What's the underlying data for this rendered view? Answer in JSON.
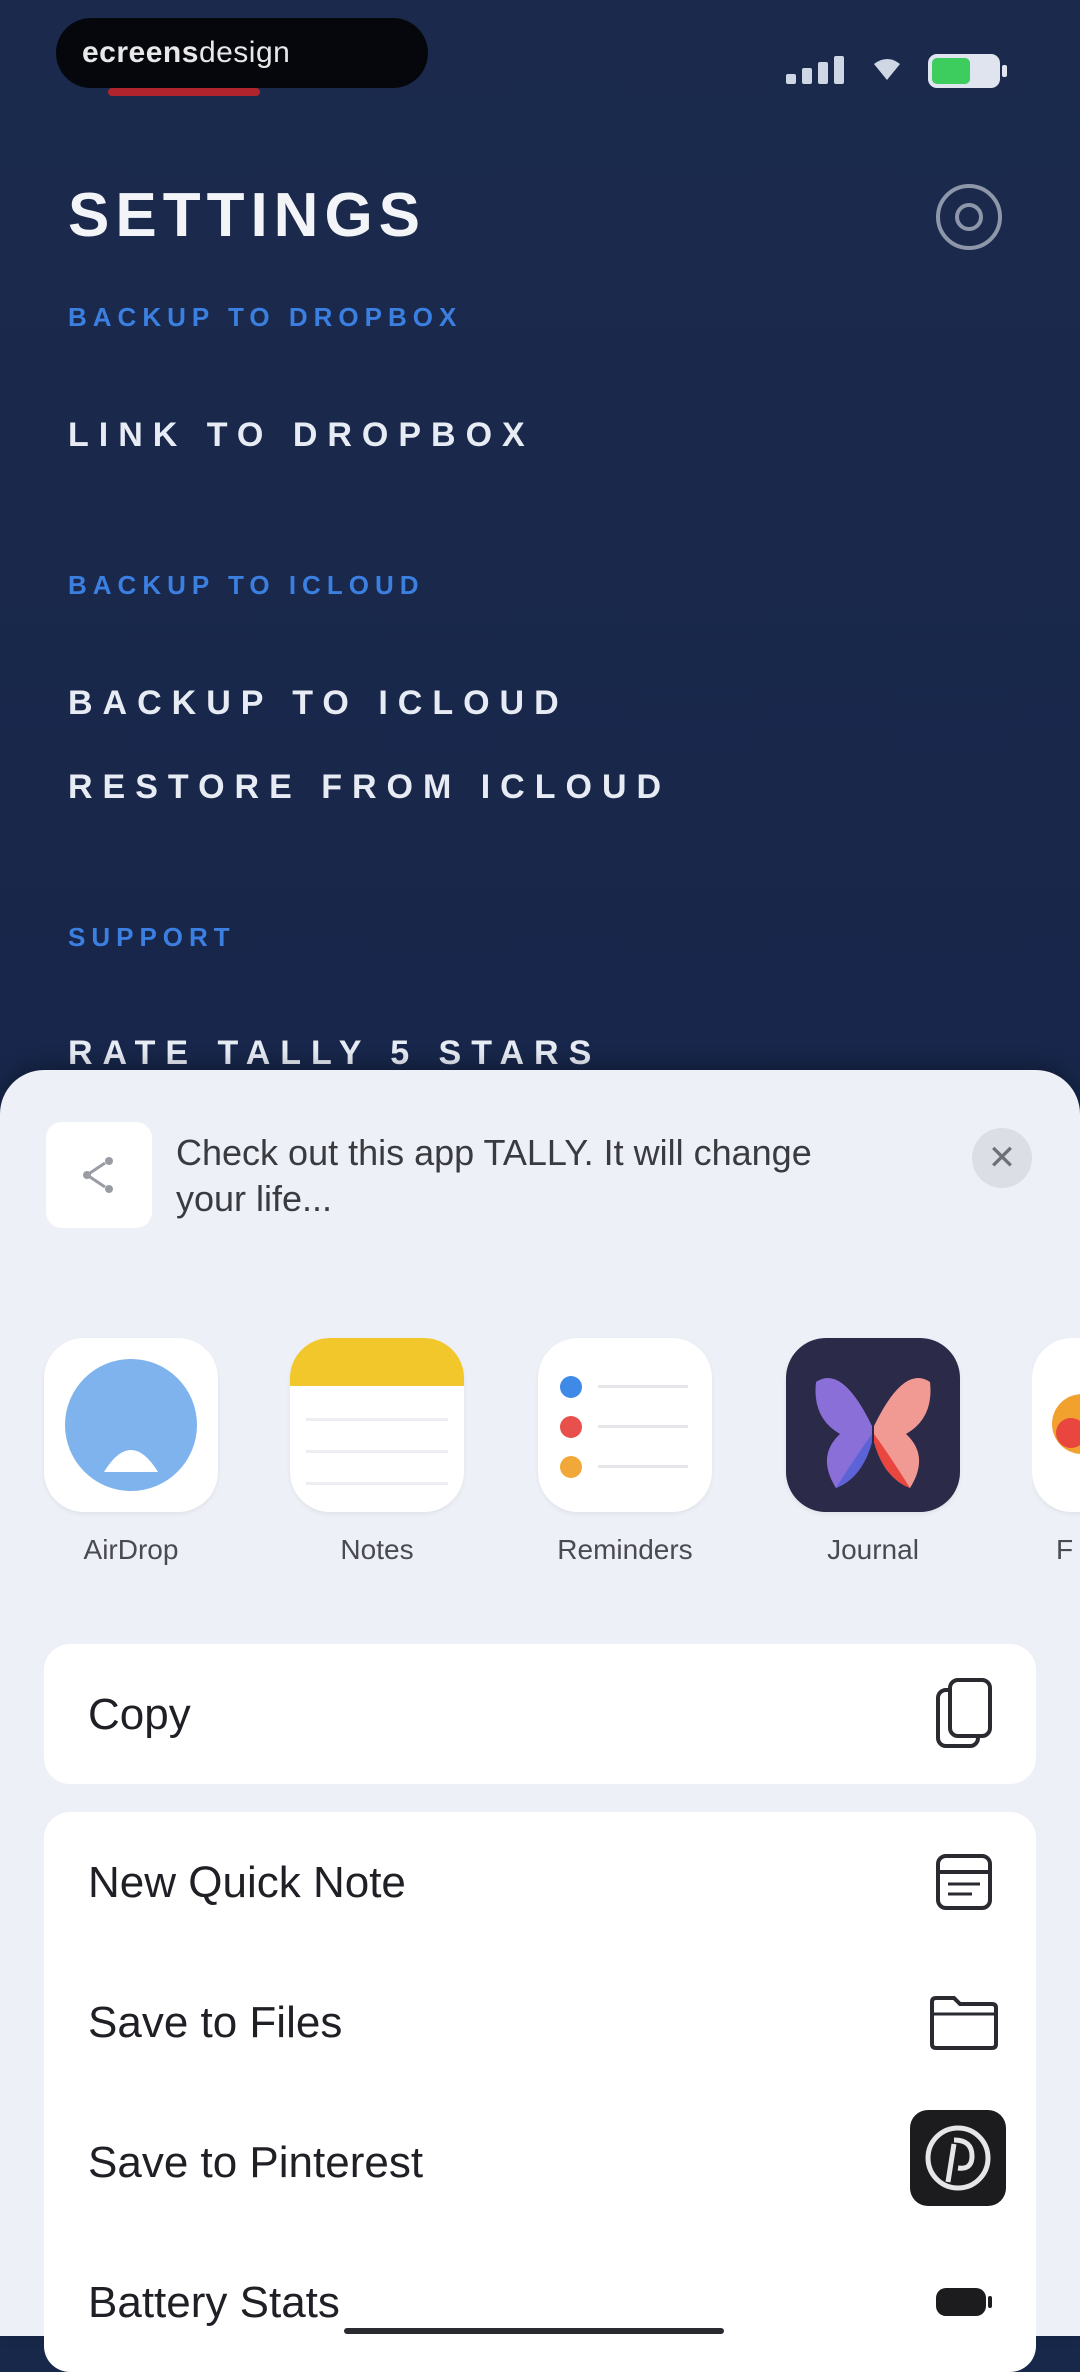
{
  "status_bar": {
    "pill_bold": "ecreens",
    "pill_light": "design"
  },
  "settings": {
    "title": "SETTINGS",
    "sections": [
      {
        "heading": "BACKUP TO DROPBOX",
        "items": [
          "LINK TO DROPBOX"
        ]
      },
      {
        "heading": "BACKUP TO ICLOUD",
        "items": [
          "BACKUP TO ICLOUD",
          "RESTORE FROM ICLOUD"
        ]
      },
      {
        "heading": "SUPPORT",
        "items": [
          "RATE TALLY 5 STARS"
        ]
      }
    ]
  },
  "share_sheet": {
    "message": "Check out this app TALLY. It will change your life...",
    "apps": [
      {
        "label": "AirDrop",
        "icon": "airdrop-icon"
      },
      {
        "label": "Notes",
        "icon": "notes-icon"
      },
      {
        "label": "Reminders",
        "icon": "reminders-icon"
      },
      {
        "label": "Journal",
        "icon": "journal-icon"
      },
      {
        "label": "F",
        "icon": "app-icon"
      }
    ],
    "actions_primary": [
      {
        "label": "Copy",
        "icon": "copy-icon"
      }
    ],
    "actions_secondary": [
      {
        "label": "New Quick Note",
        "icon": "quick-note-icon"
      },
      {
        "label": "Save to Files",
        "icon": "folder-icon"
      },
      {
        "label": "Save to Pinterest",
        "icon": "pinterest-icon"
      },
      {
        "label": "Battery Stats",
        "icon": "battery-icon"
      }
    ]
  },
  "colors": {
    "background": "#18284a",
    "section_accent": "#3b7fe0",
    "sheet_background": "#eef0f7",
    "battery_green": "#3dcc5e"
  }
}
